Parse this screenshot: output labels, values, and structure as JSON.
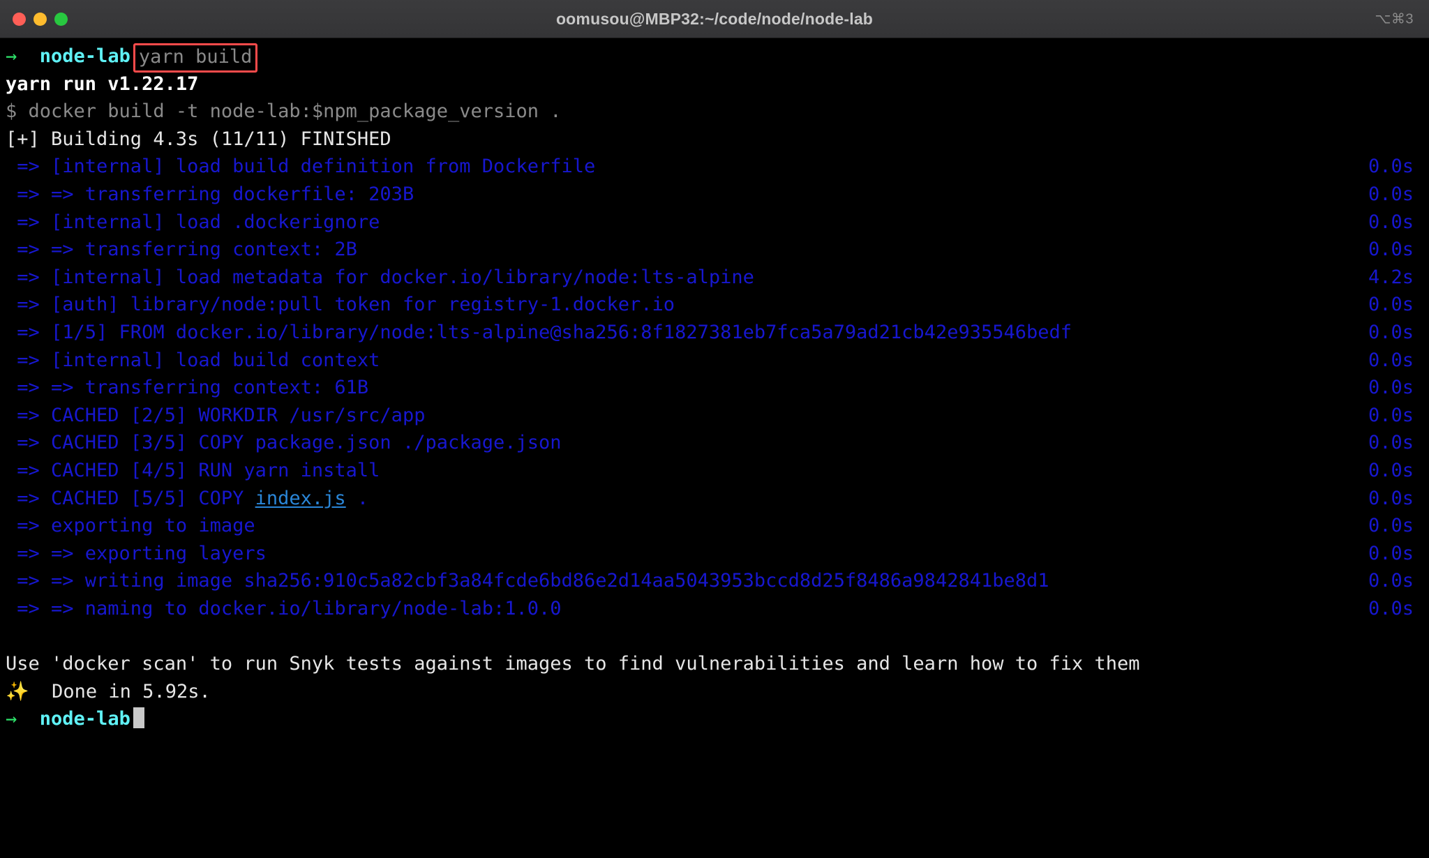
{
  "window": {
    "title": "oomusou@MBP32:~/code/node/node-lab",
    "shortcut": "⌥⌘3",
    "traffic_lights": [
      "close",
      "minimize",
      "maximize"
    ],
    "colors": {
      "background": "#000000",
      "titlebar": "#343436",
      "prompt_arrow": "#2ee36a",
      "prompt_dir": "#5ff1f5",
      "step_text": "#1717cf",
      "highlight_box": "#ff4b4b",
      "link": "#2a86d8",
      "dim_text": "#8a8a8a"
    }
  },
  "session": {
    "prompt_arrow": "→",
    "prompt_dir": "node-lab",
    "typed_command": "yarn build",
    "yarn_version_line": "yarn run v1.22.17",
    "docker_command_line": "$ docker build -t node-lab:$npm_package_version .",
    "building_header": "[+] Building 4.3s (11/11) FINISHED",
    "steps": [
      {
        "text": " => [internal] load build definition from Dockerfile",
        "time": "0.0s"
      },
      {
        "text": " => => transferring dockerfile: 203B",
        "time": "0.0s"
      },
      {
        "text": " => [internal] load .dockerignore",
        "time": "0.0s"
      },
      {
        "text": " => => transferring context: 2B",
        "time": "0.0s"
      },
      {
        "text": " => [internal] load metadata for docker.io/library/node:lts-alpine",
        "time": "4.2s"
      },
      {
        "text": " => [auth] library/node:pull token for registry-1.docker.io",
        "time": "0.0s"
      },
      {
        "text": " => [1/5] FROM docker.io/library/node:lts-alpine@sha256:8f1827381eb7fca5a79ad21cb42e935546bedf",
        "time": "0.0s"
      },
      {
        "text": " => [internal] load build context",
        "time": "0.0s"
      },
      {
        "text": " => => transferring context: 61B",
        "time": "0.0s"
      },
      {
        "text": " => CACHED [2/5] WORKDIR /usr/src/app",
        "time": "0.0s"
      },
      {
        "text": " => CACHED [3/5] COPY package.json ./package.json",
        "time": "0.0s"
      },
      {
        "text": " => CACHED [4/5] RUN yarn install",
        "time": "0.0s"
      },
      {
        "text": " => CACHED [5/5] COPY ",
        "link": "index.js",
        "text_after": " .",
        "time": "0.0s"
      },
      {
        "text": " => exporting to image",
        "time": "0.0s"
      },
      {
        "text": " => => exporting layers",
        "time": "0.0s"
      },
      {
        "text": " => => writing image sha256:910c5a82cbf3a84fcde6bd86e2d14aa5043953bccd8d25f8486a9842841be8d1",
        "time": "0.0s"
      },
      {
        "text": " => => naming to docker.io/library/node-lab:1.0.0",
        "time": "0.0s"
      }
    ],
    "snyk_message": "Use 'docker scan' to run Snyk tests against images to find vulnerabilities and learn how to fix them",
    "done_emoji": "✨",
    "done_message": "Done in 5.92s.",
    "final_prompt_arrow": "→",
    "final_prompt_dir": "node-lab"
  }
}
